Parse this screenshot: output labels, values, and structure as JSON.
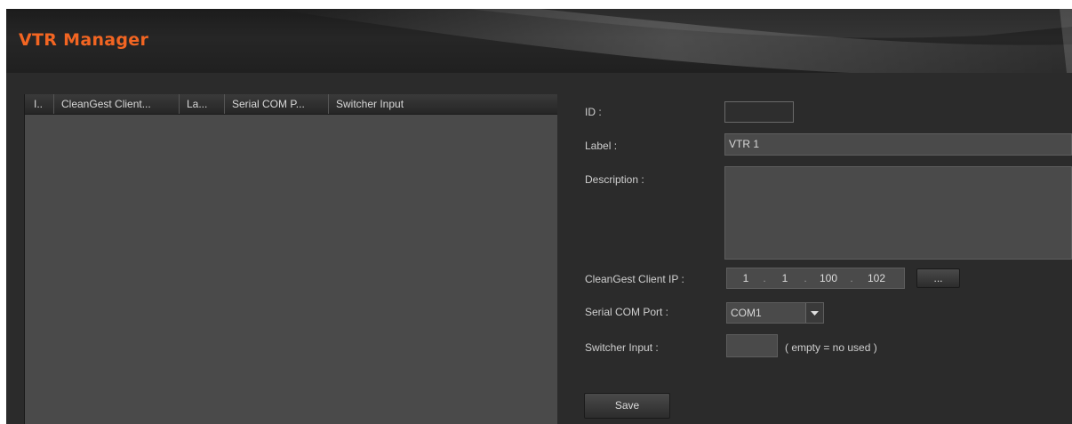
{
  "app": {
    "title": "VTR Manager"
  },
  "list": {
    "columns": [
      "I..",
      "CleanGest Client...",
      "La...",
      "Serial COM P...",
      "Switcher Input"
    ]
  },
  "form": {
    "id_label": "ID :",
    "id_value": "",
    "label_label": "Label :",
    "label_value": "VTR 1",
    "description_label": "Description :",
    "description_value": "",
    "ip_label": "CleanGest Client IP :",
    "ip": [
      "1",
      "1",
      "100",
      "102"
    ],
    "ip_sep": ".",
    "browse_label": "...",
    "com_label": "Serial COM Port :",
    "com_value": "COM1",
    "switcher_label": "Switcher Input :",
    "switcher_value": "",
    "switcher_hint": "( empty = no used )",
    "save_label": "Save"
  },
  "colors": {
    "accent": "#f26522",
    "background": "#2b2b2b",
    "field": "#4a4a4a"
  },
  "icons": {
    "dropdown": "chevron-down-icon"
  }
}
